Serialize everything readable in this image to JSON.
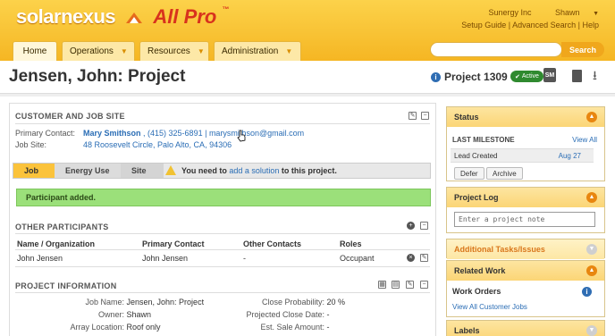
{
  "header": {
    "logo_solar": "solarnexus",
    "logo_allpro": "All Pro",
    "logo_tm": "™",
    "company": "Sunergy Inc",
    "user": "Shawn",
    "links": [
      "Setup Guide",
      "Advanced Search",
      "Help"
    ],
    "tabs": [
      {
        "label": "Home"
      },
      {
        "label": "Operations"
      },
      {
        "label": "Resources"
      },
      {
        "label": "Administration"
      }
    ],
    "search_button": "Search"
  },
  "title": {
    "page_title": "Jensen, John: Project",
    "project_number": "Project 1309",
    "status": "Active",
    "sm_icon": "SM"
  },
  "customer": {
    "section": "CUSTOMER AND JOB SITE",
    "primary_contact_label": "Primary Contact:",
    "primary_contact_name": "Mary Smithson",
    "primary_contact_phone": ", (415) 325-6891 |",
    "primary_contact_email": "marysmithson@gmail.com",
    "job_site_label": "Job Site:",
    "job_site_address": "48 Roosevelt Circle, Palo Alto, CA, 94306"
  },
  "subtabs": {
    "job": "Job",
    "energy": "Energy Use",
    "site": "Site",
    "warning_pre": "You need to",
    "warning_link": "add a solution",
    "warning_post": "to this project."
  },
  "alert": "Participant added.",
  "participants": {
    "section": "OTHER PARTICIPANTS",
    "headers": [
      "Name / Organization",
      "Primary Contact",
      "Other Contacts",
      "Roles"
    ],
    "rows": [
      {
        "name": "John Jensen",
        "primary": "John Jensen",
        "other": "-",
        "role": "Occupant"
      }
    ]
  },
  "project_info": {
    "section": "PROJECT INFORMATION",
    "left": [
      {
        "k": "Job Name:",
        "v": "Jensen, John: Project"
      },
      {
        "k": "Owner:",
        "v": "Shawn"
      },
      {
        "k": "Array Location:",
        "v": "Roof only"
      }
    ],
    "right": [
      {
        "k": "Close Probability:",
        "v": "20 %"
      },
      {
        "k": "Projected Close Date:",
        "v": "-"
      },
      {
        "k": "Est. Sale Amount:",
        "v": "-"
      }
    ]
  },
  "sidebar": {
    "status_title": "Status",
    "last_milestone": "LAST MILESTONE",
    "view_all": "View All",
    "milestone_name": "Lead Created",
    "milestone_date": "Aug 27",
    "defer": "Defer",
    "archive": "Archive",
    "log_title": "Project Log",
    "log_placeholder": "Enter a project note",
    "tasks_title": "Additional Tasks/Issues",
    "related_title": "Related Work",
    "work_orders": "Work Orders",
    "view_customer_jobs": "View All Customer Jobs",
    "labels_title": "Labels"
  },
  "colors": {
    "header": "#f5b623",
    "accent_orange": "#e8860f",
    "link": "#2a6db5",
    "success": "#9be07a",
    "active": "#2f8a2f"
  }
}
